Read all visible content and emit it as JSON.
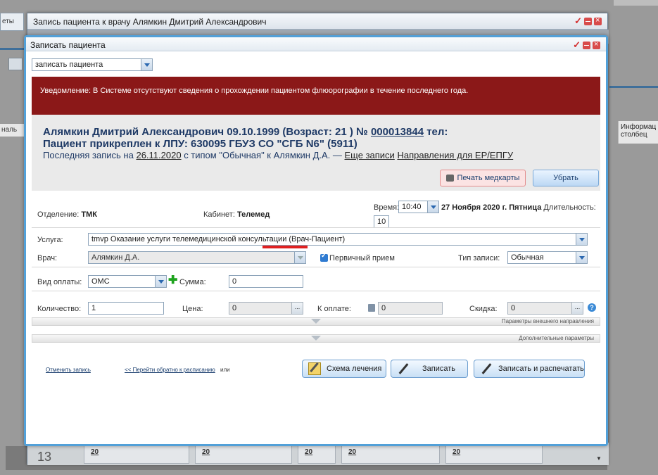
{
  "background": {
    "left_top_label": "еты",
    "left_mid_label": "наль",
    "right_header": "Информац столбец",
    "footer_numbers": [
      "20",
      "20",
      "20",
      "20",
      "20"
    ],
    "footer_big_number": "13"
  },
  "outer_window": {
    "title": "Запись пациента к врачу Алямкин Дмитрий Александрович"
  },
  "dialog": {
    "title": "Записать пациента",
    "action_select": {
      "value": "записать пациента"
    },
    "notice": "Уведомление: В Системе отсутствуют сведения о прохождении пациентом флюорографии в течение последнего года.",
    "patient": {
      "line1_prefix": "Алямкин Дмитрий Александрович 09.10.1999 (Возраст: 21 ) № ",
      "card_number": "000013844",
      "line1_suffix": " тел:",
      "line2": "Пациент прикреплен к ЛПУ: 630095 ГБУЗ СО \"СГБ N6\" (5911)",
      "last_prefix": "Последняя запись на ",
      "last_date": "26.11.2020",
      "last_middle": " с типом \"Обычная\" к Алямкин Д.А. — ",
      "more_records": "Еще записи",
      "referrals": "Направления для ЕР/ЕПГУ"
    },
    "buttons": {
      "print_card": "Печать медкарты",
      "remove": "Убрать"
    },
    "form": {
      "department_label": "Отделение:",
      "department_value": "ТМК",
      "cabinet_label": "Кабинет:",
      "cabinet_value": "Телемед",
      "time_label": "Время:",
      "time_value": "10:40",
      "date_text": "27 Ноября 2020 г. Пятница",
      "duration_label": "Длительность:",
      "duration_value": "10",
      "service_label": "Услуга:",
      "service_value": "tmvp Оказание услуги телемедицинской консультации (Врач-Пациент)",
      "doctor_label": "Врач:",
      "doctor_value": "Алямкин Д.А.",
      "primary_label": "Первичный прием",
      "record_type_label": "Тип записи:",
      "record_type_value": "Обычная",
      "payment_label": "Вид оплаты:",
      "payment_value": "ОМС",
      "sum_label": "Сумма:",
      "sum_value": "0",
      "quantity_label": "Количество:",
      "quantity_value": "1",
      "price_label": "Цена:",
      "price_value": "0",
      "to_pay_label": "К оплате:",
      "to_pay_value": "0",
      "discount_label": "Скидка:",
      "discount_value": "0",
      "ext_params": "Параметры внешнего направления",
      "add_params": "Дополнительные параметры"
    },
    "footer": {
      "cancel_link": "Отменить запись",
      "back_link": "<< Перейти обратно к расписанию",
      "or_text": "или",
      "scheme_btn": "Схема лечения",
      "record_btn": "Записать",
      "record_print_btn": "Записать и распечатать"
    }
  }
}
